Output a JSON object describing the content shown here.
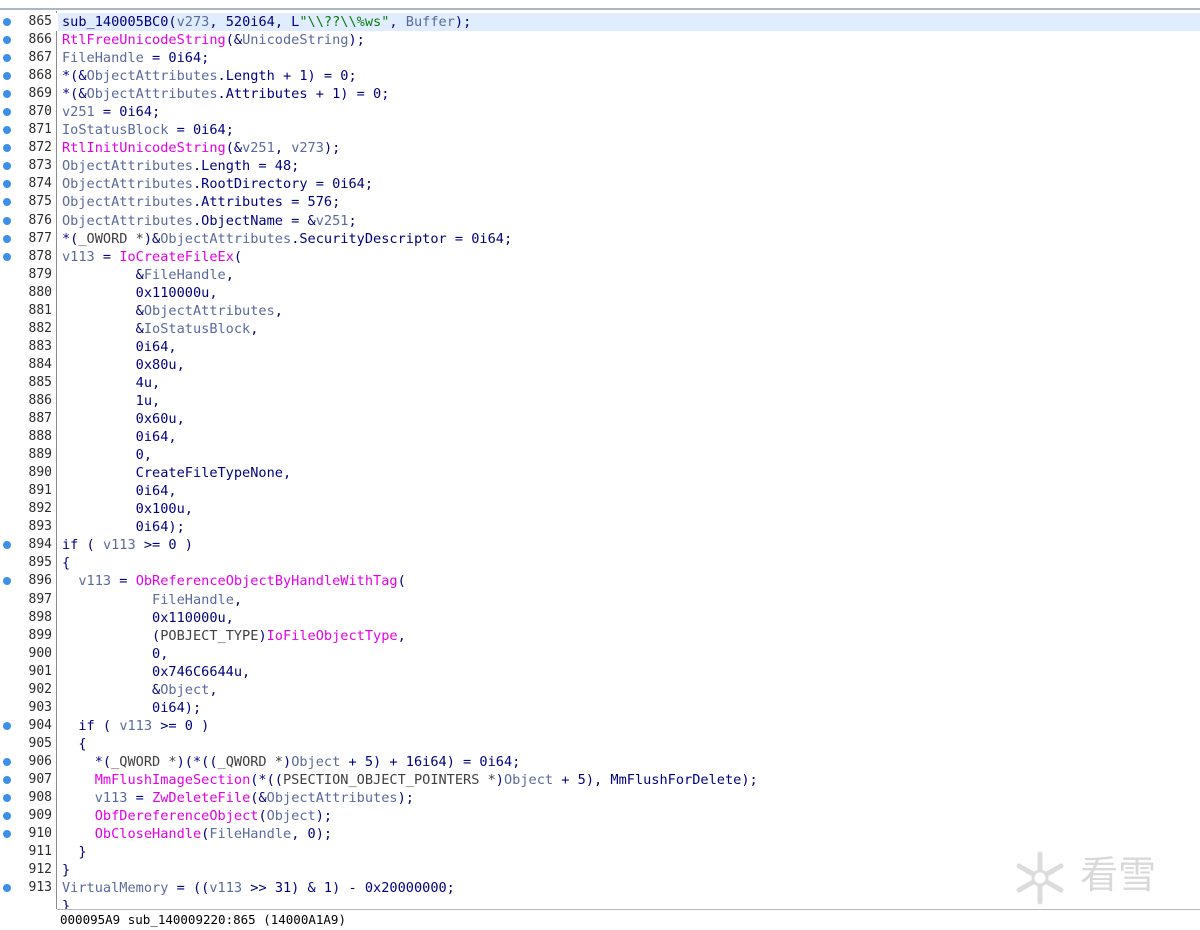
{
  "status": {
    "text": "000095A9 sub_140009220:865 (14000A1A9)"
  },
  "watermark": {
    "text": "看雪"
  },
  "colors": {
    "api": "#e600e6",
    "var": "#5a6b9b",
    "plain": "#000080",
    "string": "#0a7d0a",
    "breakpoint": "#3d8fe8"
  },
  "lines": [
    {
      "n": "865",
      "bp": true,
      "current": true,
      "tokens": [
        [
          "fn",
          "sub_140005BC0"
        ],
        [
          "plain",
          "("
        ],
        [
          "var",
          "v273"
        ],
        [
          "plain",
          ", 520i64, L"
        ],
        [
          "str",
          "\"\\\\??\\\\%ws\""
        ],
        [
          "plain",
          ", "
        ],
        [
          "var",
          "Buffer"
        ],
        [
          "plain",
          ");"
        ]
      ]
    },
    {
      "n": "866",
      "bp": true,
      "tokens": [
        [
          "api",
          "RtlFreeUnicodeString"
        ],
        [
          "plain",
          "(&"
        ],
        [
          "var",
          "UnicodeString"
        ],
        [
          "plain",
          ");"
        ]
      ]
    },
    {
      "n": "867",
      "bp": true,
      "tokens": [
        [
          "var",
          "FileHandle"
        ],
        [
          "plain",
          " = 0i64;"
        ]
      ]
    },
    {
      "n": "868",
      "bp": true,
      "tokens": [
        [
          "plain",
          "*(&"
        ],
        [
          "var",
          "ObjectAttributes"
        ],
        [
          "plain",
          ".Length + 1) = 0;"
        ]
      ]
    },
    {
      "n": "869",
      "bp": true,
      "tokens": [
        [
          "plain",
          "*(&"
        ],
        [
          "var",
          "ObjectAttributes"
        ],
        [
          "plain",
          ".Attributes + 1) = 0;"
        ]
      ]
    },
    {
      "n": "870",
      "bp": true,
      "tokens": [
        [
          "var",
          "v251"
        ],
        [
          "plain",
          " = 0i64;"
        ]
      ]
    },
    {
      "n": "871",
      "bp": true,
      "tokens": [
        [
          "var",
          "IoStatusBlock"
        ],
        [
          "plain",
          " = 0i64;"
        ]
      ]
    },
    {
      "n": "872",
      "bp": true,
      "tokens": [
        [
          "api",
          "RtlInitUnicodeString"
        ],
        [
          "plain",
          "(&"
        ],
        [
          "var",
          "v251"
        ],
        [
          "plain",
          ", "
        ],
        [
          "var",
          "v273"
        ],
        [
          "plain",
          ");"
        ]
      ]
    },
    {
      "n": "873",
      "bp": true,
      "tokens": [
        [
          "var",
          "ObjectAttributes"
        ],
        [
          "plain",
          ".Length = 48;"
        ]
      ]
    },
    {
      "n": "874",
      "bp": true,
      "tokens": [
        [
          "var",
          "ObjectAttributes"
        ],
        [
          "plain",
          ".RootDirectory = 0i64;"
        ]
      ]
    },
    {
      "n": "875",
      "bp": true,
      "tokens": [
        [
          "var",
          "ObjectAttributes"
        ],
        [
          "plain",
          ".Attributes = 576;"
        ]
      ]
    },
    {
      "n": "876",
      "bp": true,
      "tokens": [
        [
          "var",
          "ObjectAttributes"
        ],
        [
          "plain",
          ".ObjectName = &"
        ],
        [
          "var",
          "v251"
        ],
        [
          "plain",
          ";"
        ]
      ]
    },
    {
      "n": "877",
      "bp": true,
      "tokens": [
        [
          "plain",
          "*("
        ],
        [
          "type",
          "_OWORD *"
        ],
        [
          "plain",
          ")&"
        ],
        [
          "var",
          "ObjectAttributes"
        ],
        [
          "plain",
          ".SecurityDescriptor = 0i64;"
        ]
      ]
    },
    {
      "n": "878",
      "bp": true,
      "tokens": [
        [
          "var",
          "v113"
        ],
        [
          "plain",
          " = "
        ],
        [
          "api",
          "IoCreateFileEx"
        ],
        [
          "plain",
          "("
        ]
      ]
    },
    {
      "n": "879",
      "bp": false,
      "tokens": [
        [
          "plain",
          "         &"
        ],
        [
          "var",
          "FileHandle"
        ],
        [
          "plain",
          ","
        ]
      ]
    },
    {
      "n": "880",
      "bp": false,
      "tokens": [
        [
          "plain",
          "         0x110000u,"
        ]
      ]
    },
    {
      "n": "881",
      "bp": false,
      "tokens": [
        [
          "plain",
          "         &"
        ],
        [
          "var",
          "ObjectAttributes"
        ],
        [
          "plain",
          ","
        ]
      ]
    },
    {
      "n": "882",
      "bp": false,
      "tokens": [
        [
          "plain",
          "         &"
        ],
        [
          "var",
          "IoStatusBlock"
        ],
        [
          "plain",
          ","
        ]
      ]
    },
    {
      "n": "883",
      "bp": false,
      "tokens": [
        [
          "plain",
          "         0i64,"
        ]
      ]
    },
    {
      "n": "884",
      "bp": false,
      "tokens": [
        [
          "plain",
          "         0x80u,"
        ]
      ]
    },
    {
      "n": "885",
      "bp": false,
      "tokens": [
        [
          "plain",
          "         4u,"
        ]
      ]
    },
    {
      "n": "886",
      "bp": false,
      "tokens": [
        [
          "plain",
          "         1u,"
        ]
      ]
    },
    {
      "n": "887",
      "bp": false,
      "tokens": [
        [
          "plain",
          "         0x60u,"
        ]
      ]
    },
    {
      "n": "888",
      "bp": false,
      "tokens": [
        [
          "plain",
          "         0i64,"
        ]
      ]
    },
    {
      "n": "889",
      "bp": false,
      "tokens": [
        [
          "plain",
          "         0,"
        ]
      ]
    },
    {
      "n": "890",
      "bp": false,
      "tokens": [
        [
          "plain",
          "         CreateFileTypeNone,"
        ]
      ]
    },
    {
      "n": "891",
      "bp": false,
      "tokens": [
        [
          "plain",
          "         0i64,"
        ]
      ]
    },
    {
      "n": "892",
      "bp": false,
      "tokens": [
        [
          "plain",
          "         0x100u,"
        ]
      ]
    },
    {
      "n": "893",
      "bp": false,
      "tokens": [
        [
          "plain",
          "         0i64);"
        ]
      ]
    },
    {
      "n": "894",
      "bp": true,
      "tokens": [
        [
          "kw",
          "if"
        ],
        [
          "plain",
          " ( "
        ],
        [
          "var",
          "v113"
        ],
        [
          "plain",
          " >= 0 )"
        ]
      ]
    },
    {
      "n": "895",
      "bp": false,
      "tokens": [
        [
          "plain",
          "{"
        ]
      ]
    },
    {
      "n": "896",
      "bp": true,
      "tokens": [
        [
          "plain",
          "  "
        ],
        [
          "var",
          "v113"
        ],
        [
          "plain",
          " = "
        ],
        [
          "api",
          "ObReferenceObjectByHandleWithTag"
        ],
        [
          "plain",
          "("
        ]
      ]
    },
    {
      "n": "897",
      "bp": false,
      "tokens": [
        [
          "plain",
          "           "
        ],
        [
          "var",
          "FileHandle"
        ],
        [
          "plain",
          ","
        ]
      ]
    },
    {
      "n": "898",
      "bp": false,
      "tokens": [
        [
          "plain",
          "           0x110000u,"
        ]
      ]
    },
    {
      "n": "899",
      "bp": false,
      "tokens": [
        [
          "plain",
          "           ("
        ],
        [
          "type",
          "POBJECT_TYPE"
        ],
        [
          "plain",
          ")"
        ],
        [
          "api",
          "IoFileObjectType"
        ],
        [
          "plain",
          ","
        ]
      ]
    },
    {
      "n": "900",
      "bp": false,
      "tokens": [
        [
          "plain",
          "           0,"
        ]
      ]
    },
    {
      "n": "901",
      "bp": false,
      "tokens": [
        [
          "plain",
          "           0x746C6644u,"
        ]
      ]
    },
    {
      "n": "902",
      "bp": false,
      "tokens": [
        [
          "plain",
          "           &"
        ],
        [
          "var",
          "Object"
        ],
        [
          "plain",
          ","
        ]
      ]
    },
    {
      "n": "903",
      "bp": false,
      "tokens": [
        [
          "plain",
          "           0i64);"
        ]
      ]
    },
    {
      "n": "904",
      "bp": true,
      "tokens": [
        [
          "plain",
          "  "
        ],
        [
          "kw",
          "if"
        ],
        [
          "plain",
          " ( "
        ],
        [
          "var",
          "v113"
        ],
        [
          "plain",
          " >= 0 )"
        ]
      ]
    },
    {
      "n": "905",
      "bp": false,
      "tokens": [
        [
          "plain",
          "  {"
        ]
      ]
    },
    {
      "n": "906",
      "bp": true,
      "tokens": [
        [
          "plain",
          "    *("
        ],
        [
          "type",
          "_QWORD *"
        ],
        [
          "plain",
          ")(*(("
        ],
        [
          "type",
          "_QWORD *"
        ],
        [
          "plain",
          ")"
        ],
        [
          "var",
          "Object"
        ],
        [
          "plain",
          " + 5) + 16i64) = 0i64;"
        ]
      ]
    },
    {
      "n": "907",
      "bp": true,
      "tokens": [
        [
          "plain",
          "    "
        ],
        [
          "api",
          "MmFlushImageSection"
        ],
        [
          "plain",
          "(*(("
        ],
        [
          "type",
          "PSECTION_OBJECT_POINTERS *"
        ],
        [
          "plain",
          ")"
        ],
        [
          "var",
          "Object"
        ],
        [
          "plain",
          " + 5), MmFlushForDelete);"
        ]
      ]
    },
    {
      "n": "908",
      "bp": true,
      "tokens": [
        [
          "plain",
          "    "
        ],
        [
          "var",
          "v113"
        ],
        [
          "plain",
          " = "
        ],
        [
          "api",
          "ZwDeleteFile"
        ],
        [
          "plain",
          "(&"
        ],
        [
          "var",
          "ObjectAttributes"
        ],
        [
          "plain",
          ");"
        ]
      ]
    },
    {
      "n": "909",
      "bp": true,
      "tokens": [
        [
          "plain",
          "    "
        ],
        [
          "api",
          "ObfDereferenceObject"
        ],
        [
          "plain",
          "("
        ],
        [
          "var",
          "Object"
        ],
        [
          "plain",
          ");"
        ]
      ]
    },
    {
      "n": "910",
      "bp": true,
      "tokens": [
        [
          "plain",
          "    "
        ],
        [
          "api",
          "ObCloseHandle"
        ],
        [
          "plain",
          "("
        ],
        [
          "var",
          "FileHandle"
        ],
        [
          "plain",
          ", 0);"
        ]
      ]
    },
    {
      "n": "911",
      "bp": false,
      "tokens": [
        [
          "plain",
          "  }"
        ]
      ]
    },
    {
      "n": "912",
      "bp": false,
      "tokens": [
        [
          "plain",
          "}"
        ]
      ]
    },
    {
      "n": "913",
      "bp": true,
      "tokens": [
        [
          "var",
          "VirtualMemory"
        ],
        [
          "plain",
          " = (("
        ],
        [
          "var",
          "v113"
        ],
        [
          "plain",
          " >> 31) & 1) - 0x20000000;"
        ]
      ]
    },
    {
      "n": "",
      "bp": false,
      "tokens": [
        [
          "plain",
          "}"
        ]
      ]
    }
  ]
}
